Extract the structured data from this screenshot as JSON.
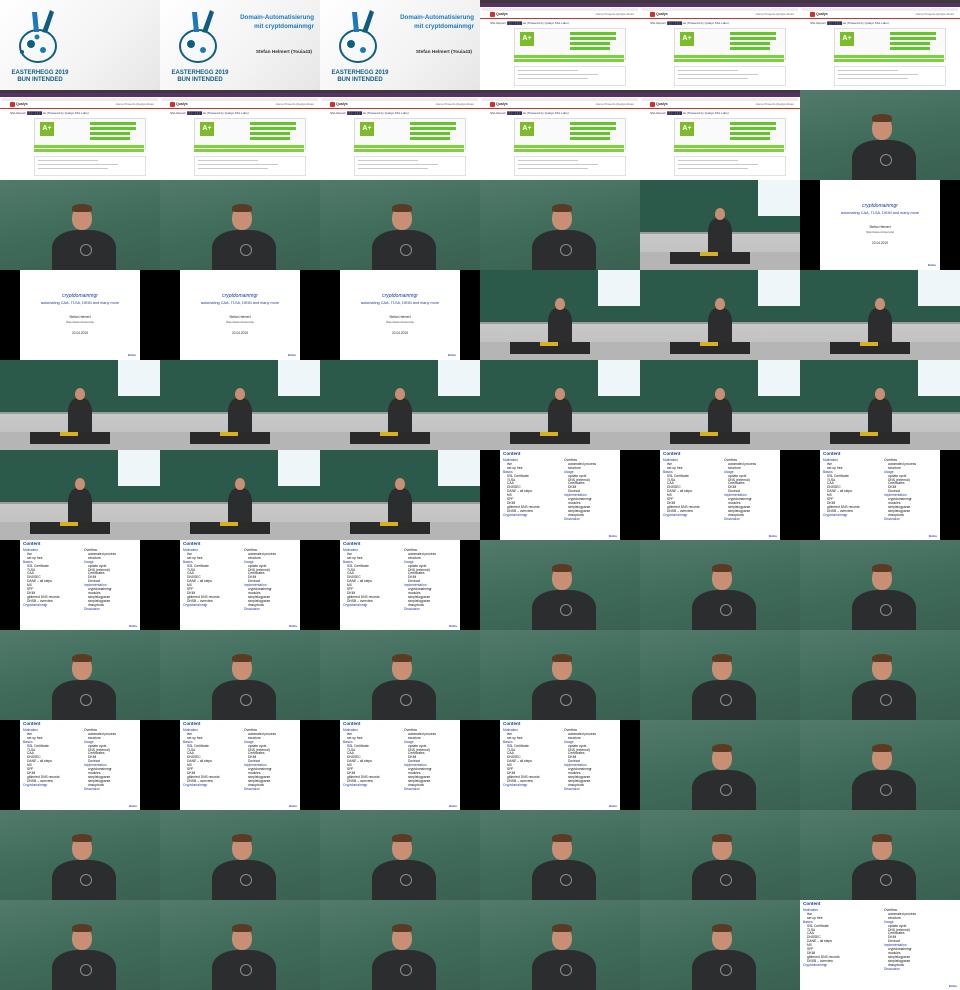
{
  "title_slide": {
    "event_line1": "EASTERHEGG 2019",
    "event_line2": "BUN INTENDED",
    "title_line1": "Domain-Automatisierung",
    "title_line2": "mit cryptdomainmgr",
    "author": "Stefan Helmert (Touia43)"
  },
  "browser": {
    "brand": "Qualys",
    "menu": "Home  Projects  Qualys  About",
    "crumb": "SSL Report: ███████.de (Powered by Qualys SSL Labs)",
    "grade": "A+",
    "accent": "#7dbb2b"
  },
  "intro_slide": {
    "title": "cryptdomainmgr",
    "subtitle": "automating CAA, TLSA, DKIM and many more",
    "author": "Stefan Helmert",
    "url": "https://www.entroserv.de/",
    "date": "20.04.2019",
    "logo": "Entro"
  },
  "toc": {
    "heading": "Content",
    "logo": "Entro",
    "left": [
      {
        "kind": "sec",
        "text": "Motivation"
      },
      {
        "kind": "sub",
        "text": "live"
      },
      {
        "kind": "sub",
        "text": "set up free"
      },
      {
        "kind": "sec",
        "text": "Basics"
      },
      {
        "kind": "sub",
        "text": "SSL Certificate"
      },
      {
        "kind": "sub",
        "text": "TLSA"
      },
      {
        "kind": "sub",
        "text": "CAA"
      },
      {
        "kind": "sub",
        "text": "DNSSEC"
      },
      {
        "kind": "sub",
        "text": "DANE – all steps"
      },
      {
        "kind": "sub",
        "text": "MX"
      },
      {
        "kind": "sub",
        "text": "SPF"
      },
      {
        "kind": "sub",
        "text": "DKIM"
      },
      {
        "kind": "sub",
        "text": "gibbered DNS records"
      },
      {
        "kind": "sub",
        "text": "DNSB – overview"
      },
      {
        "kind": "sec",
        "text": "Cryptdomainmgr"
      }
    ],
    "right": [
      {
        "kind": "plain",
        "text": "Overflow"
      },
      {
        "kind": "sub",
        "text": "automated process"
      },
      {
        "kind": "sub",
        "text": "structure"
      },
      {
        "kind": "sec",
        "text": "Usage"
      },
      {
        "kind": "sub",
        "text": "update cycle"
      },
      {
        "kind": "sub",
        "text": "DNS (external)"
      },
      {
        "kind": "sub",
        "text": "Certificates"
      },
      {
        "kind": "sub",
        "text": "DKIM"
      },
      {
        "kind": "sub",
        "text": "Dovecot"
      },
      {
        "kind": "sec",
        "text": "Implementation"
      },
      {
        "kind": "sub",
        "text": "cryptdomainmgr"
      },
      {
        "kind": "sub",
        "text": "modules"
      },
      {
        "kind": "sub",
        "text": "simplelogparse"
      },
      {
        "kind": "sub",
        "text": "simplelogparse"
      },
      {
        "kind": "sub",
        "text": "dnsuptools"
      },
      {
        "kind": "sec",
        "text": "Discussion"
      }
    ]
  },
  "cells": [
    "title-bunny",
    "title",
    "title",
    "browser",
    "browser",
    "browser",
    "browser",
    "browser",
    "browser",
    "browser",
    "browser",
    "speaker-close",
    "speaker-close",
    "speaker-close",
    "speaker-close",
    "speaker-close",
    "speaker-wide",
    "intro-slide",
    "intro-slide",
    "intro-slide",
    "intro-slide",
    "speaker-wide",
    "speaker-wide",
    "speaker-wide",
    "speaker-wide",
    "speaker-wide",
    "speaker-wide",
    "speaker-wide",
    "speaker-wide",
    "speaker-wide",
    "speaker-wide",
    "speaker-wide",
    "speaker-wide",
    "toc",
    "toc",
    "toc",
    "toc",
    "toc",
    "toc",
    "speaker-close",
    "speaker-close",
    "speaker-close",
    "speaker-close",
    "speaker-close",
    "speaker-close",
    "speaker-close",
    "speaker-close",
    "speaker-close",
    "toc",
    "toc",
    "toc",
    "toc",
    "speaker-close",
    "speaker-close",
    "speaker-close",
    "speaker-close",
    "speaker-close",
    "speaker-close",
    "speaker-close",
    "speaker-close",
    "speaker-close",
    "speaker-close",
    "speaker-close",
    "speaker-close",
    "speaker-close",
    "toc-full"
  ]
}
